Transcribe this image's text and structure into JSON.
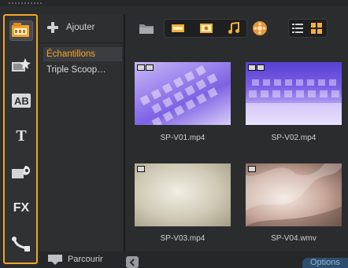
{
  "panel": {
    "add_label": "Ajouter",
    "browse_label": "Parcourir",
    "options_label": "Options"
  },
  "folders": [
    {
      "label": "Échantillons",
      "selected": true
    },
    {
      "label": "Triple Scoop…",
      "selected": false
    }
  ],
  "tools": [
    {
      "name": "media",
      "icon": "media-icon",
      "active": true
    },
    {
      "name": "instant-project",
      "icon": "instant-project-icon"
    },
    {
      "name": "title-ab",
      "icon": "ab-transition-icon",
      "text": "AB"
    },
    {
      "name": "title",
      "icon": "title-icon",
      "text": "T"
    },
    {
      "name": "graphics",
      "icon": "graphics-icon"
    },
    {
      "name": "filters",
      "icon": "fx-icon",
      "text": "FX"
    },
    {
      "name": "motion-path",
      "icon": "path-icon"
    }
  ],
  "filters": [
    {
      "icon": "video-filter-icon"
    },
    {
      "icon": "photo-filter-icon"
    },
    {
      "icon": "audio-filter-icon"
    }
  ],
  "thumbnails": [
    {
      "label": "SP-V01.mp4"
    },
    {
      "label": "SP-V02.mp4"
    },
    {
      "label": "SP-V03.mp4"
    },
    {
      "label": "SP-V04.wmv"
    }
  ],
  "colors": {
    "accent": "#f0a526",
    "selected_text": "#f5a623",
    "panel_bg": "#2b2c2e",
    "options_bg": "#2f4d6c"
  }
}
